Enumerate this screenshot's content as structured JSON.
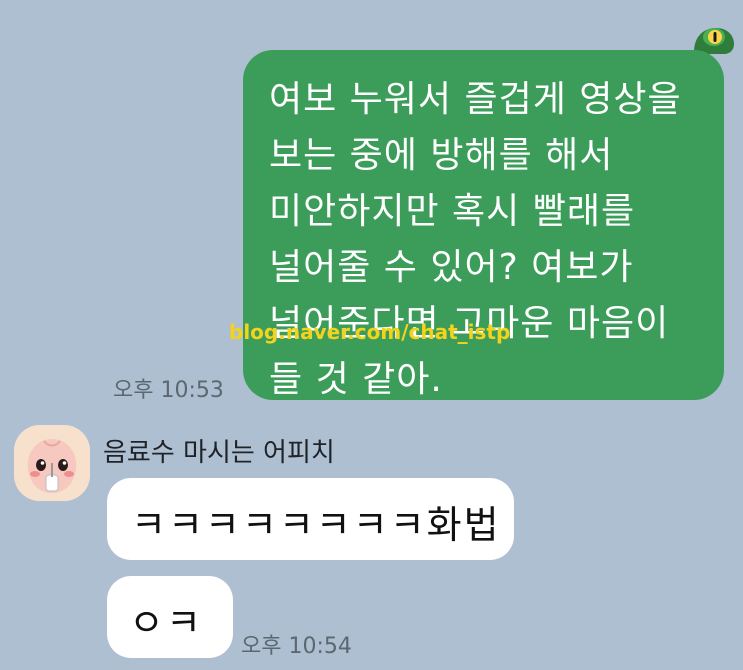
{
  "conversation": {
    "outgoing": {
      "message": "여보 누워서 즐겁게 영상을 보는 중에 방해를 해서 미안하지만 혹시 빨래를 널어줄 수 있어? 여보가 널어준다면 고마운 마음이 들 것 같아.",
      "time": "오후 10:53",
      "sticker_icon": "frog-icon"
    },
    "watermark": "blog.naver.com/chat_istp",
    "incoming": {
      "sender_name": "음료수 마시는 어피치",
      "avatar_icon": "apeach-avatar-icon",
      "messages": [
        "ㅋㅋㅋㅋㅋㅋㅋㅋ화법",
        "ㅇㅋ"
      ],
      "time": "오후 10:54"
    }
  },
  "colors": {
    "background": "#aebfd2",
    "outgoing_bubble": "#3c9d5a",
    "incoming_bubble": "#ffffff",
    "watermark": "#f3d31b"
  }
}
